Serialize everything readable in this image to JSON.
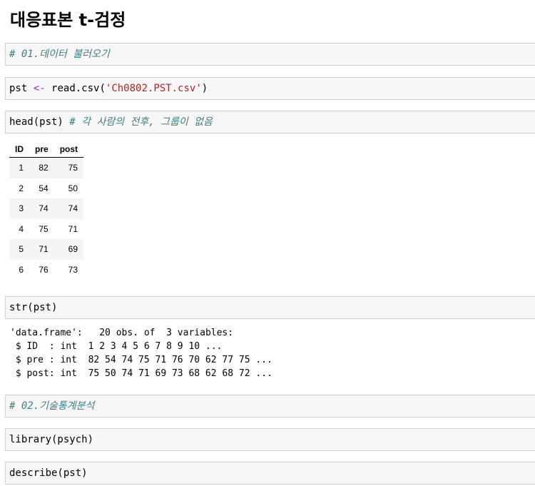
{
  "page_title": "대응표본 t-검정",
  "cells": [
    {
      "id": "c1",
      "comment": "# 01.데이터 불러오기"
    },
    {
      "id": "c2",
      "code": "pst",
      "op": "<-",
      "func": "read.csv(",
      "str": "'Ch0802.PST.csv'",
      "close": ")"
    },
    {
      "id": "c3",
      "code": "head(pst)",
      "comment": "# 각 사람의 전후, 그룹이 없음"
    },
    {
      "id": "c4",
      "code": "str(pst)"
    },
    {
      "id": "c5",
      "comment": "# 02.기술통계분석"
    },
    {
      "id": "c6",
      "code": "library(psych)"
    },
    {
      "id": "c7",
      "code": "describe(pst)"
    }
  ],
  "head_table": {
    "columns": [
      "ID",
      "pre",
      "post"
    ],
    "rows": [
      [
        "1",
        "82",
        "75"
      ],
      [
        "2",
        "54",
        "50"
      ],
      [
        "3",
        "74",
        "74"
      ],
      [
        "4",
        "75",
        "71"
      ],
      [
        "5",
        "71",
        "69"
      ],
      [
        "6",
        "76",
        "73"
      ]
    ]
  },
  "str_output": "'data.frame':\t20 obs. of  3 variables:\n $ ID  : int  1 2 3 4 5 6 7 8 9 10 ...\n $ pre : int  82 54 74 75 71 76 70 62 77 75 ...\n $ post: int  75 50 74 71 69 73 68 62 68 72 ..."
}
